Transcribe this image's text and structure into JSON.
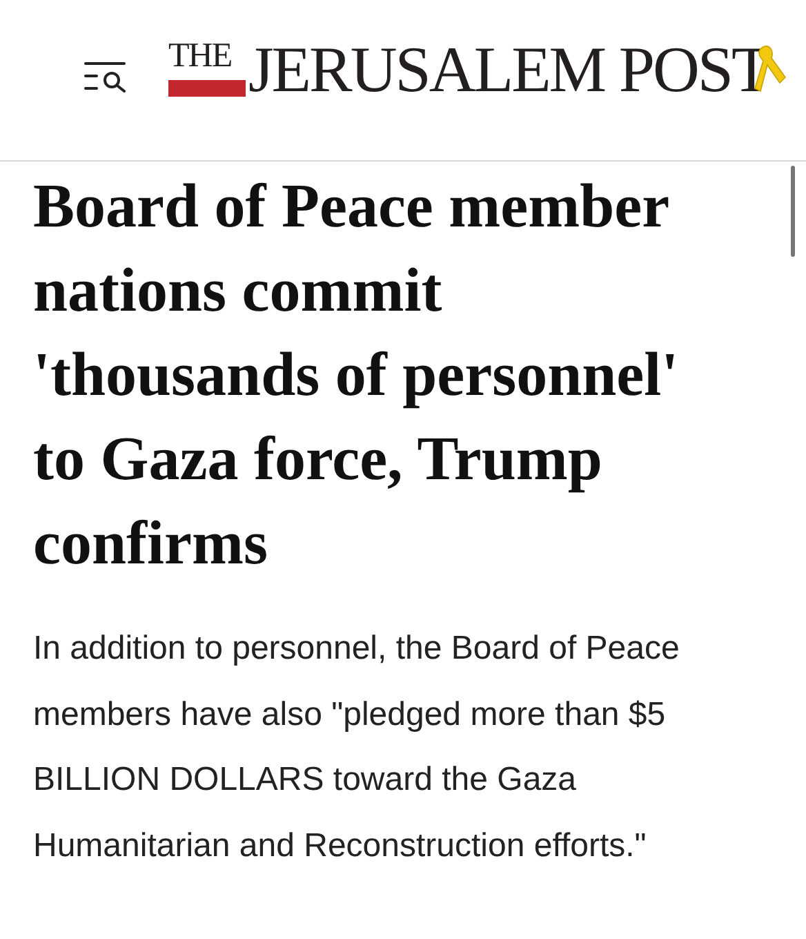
{
  "header": {
    "logo_prefix": "THE",
    "logo_name": "JERUSALEM POST"
  },
  "article": {
    "headline": "Board of Peace member nations commit 'thousands of personnel' to Gaza force, Trump confirms",
    "summary": "In addition to personnel, the Board of Peace members have also \"pledged more than $5 BILLION DOLLARS toward the Gaza Humanitarian and Reconstruction efforts.\""
  }
}
